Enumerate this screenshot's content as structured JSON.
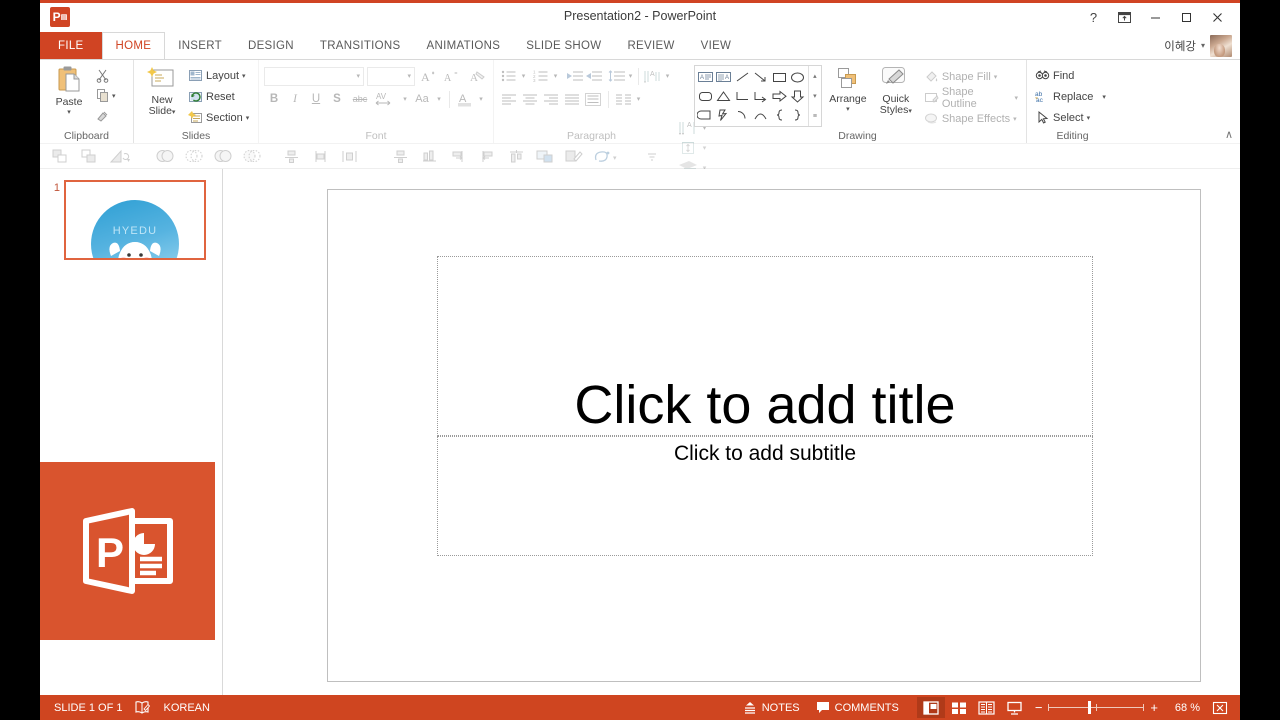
{
  "window": {
    "title": "Presentation2 - PowerPoint",
    "app_icon": "powerpoint-icon",
    "help_label": "?",
    "ribbon_display_label": "ribbon-display-options",
    "minimize_label": "—",
    "restore_label": "❐",
    "close_label": "✕",
    "account_name": "이혜강",
    "account_caret": "▾"
  },
  "tabs": [
    {
      "label": "FILE",
      "kind": "file"
    },
    {
      "label": "HOME",
      "kind": "active"
    },
    {
      "label": "INSERT",
      "kind": "normal"
    },
    {
      "label": "DESIGN",
      "kind": "normal"
    },
    {
      "label": "TRANSITIONS",
      "kind": "normal"
    },
    {
      "label": "ANIMATIONS",
      "kind": "normal"
    },
    {
      "label": "SLIDE SHOW",
      "kind": "normal"
    },
    {
      "label": "REVIEW",
      "kind": "normal"
    },
    {
      "label": "VIEW",
      "kind": "normal"
    }
  ],
  "ribbon": {
    "clipboard": {
      "label": "Clipboard",
      "paste_label": "Paste",
      "paste_caret": "▾",
      "cut_label": "Cut",
      "copy_label": "Copy",
      "copy_caret": "▾",
      "format_painter_label": "Format Painter",
      "dialog_launcher": "⬌"
    },
    "slides": {
      "label": "Slides",
      "new_slide_label": "New\nSlide",
      "new_slide_line1": "New",
      "new_slide_line2": "Slide",
      "new_slide_caret": "▾",
      "layout_label": "Layout",
      "layout_caret": "▾",
      "reset_label": "Reset",
      "section_label": "Section",
      "section_caret": "▾"
    },
    "font": {
      "label": "Font",
      "font_name_value": "",
      "font_name_placeholder": "",
      "font_size_value": "",
      "font_size_placeholder": "",
      "increase_size_label": "A▴",
      "decrease_size_label": "A▾",
      "clear_formatting_label": "Clear All Formatting",
      "bold_label": "B",
      "italic_label": "I",
      "underline_label": "U",
      "shadow_label": "S",
      "strikethrough_label": "abc",
      "char_spacing_label": "AV",
      "change_case_label": "Aa",
      "font_color_label": "A",
      "caret": "▾",
      "dialog_launcher": "⬌",
      "state": "disabled"
    },
    "paragraph": {
      "label": "Paragraph",
      "bullets_label": "Bullets",
      "numbering_label": "Numbering",
      "decrease_indent_label": "Decrease List Level",
      "increase_indent_label": "Increase List Level",
      "line_spacing_label": "Line Spacing",
      "text_direction_label": "Text Direction",
      "align_text_label": "Align Text",
      "smartart_label": "Convert to SmartArt",
      "align_left_label": "Align Left",
      "center_label": "Center",
      "align_right_label": "Align Right",
      "justify_label": "Justify",
      "columns_label": "Columns",
      "caret": "▾",
      "dialog_launcher": "⬌",
      "state": "disabled"
    },
    "drawing": {
      "label": "Drawing",
      "arrange_label": "Arrange",
      "arrange_caret": "▾",
      "quick_styles_line1": "Quick",
      "quick_styles_line2": "Styles",
      "quick_styles_caret": "▾",
      "shape_fill_label": "Shape Fill",
      "shape_outline_label": "Shape Outline",
      "shape_effects_label": "Shape Effects",
      "caret": "▾",
      "dialog_launcher": "⬌",
      "shapes": [
        "textbox",
        "vertical-textbox",
        "line",
        "line-arrow",
        "rectangle",
        "oval",
        "rounded-rectangle",
        "triangle",
        "elbow-connector",
        "elbow-arrow-connector",
        "right-arrow",
        "down-arrow",
        "pentagon-flag",
        "lightning-bolt",
        "arc",
        "curve",
        "left-brace",
        "right-brace"
      ],
      "scroll_up": "▴",
      "scroll_down": "▾",
      "scroll_more": "≡"
    },
    "editing": {
      "label": "Editing",
      "find_label": "Find",
      "replace_label": "Replace",
      "replace_caret": "▾",
      "select_label": "Select",
      "select_caret": "▾"
    },
    "collapse_ribbon_label": "∧"
  },
  "toolbar2": {
    "state": "disabled",
    "buttons": [
      "bring-forward-icon",
      "send-backward-icon",
      "rotate-icon",
      "merge-shapes-union-icon",
      "merge-shapes-combine-icon",
      "merge-shapes-fragment-icon",
      "merge-shapes-subtract-icon",
      "align-center-icon",
      "align-middle-icon",
      "distribute-horizontal-icon",
      "align-bottom-icon",
      "distribute-vertical-icon",
      "align-right-icon",
      "align-left-icon",
      "align-top-icon",
      "group-icon",
      "edit-points-icon",
      "shape-icon",
      "more-icon"
    ]
  },
  "thumbnails": {
    "slides": [
      {
        "number": "1",
        "mascot_text": "HYEDU",
        "mascot_name": "hyedu-mascot"
      }
    ],
    "overlay_logo": "powerpoint-logo"
  },
  "slide": {
    "title_placeholder": "Click to add title",
    "subtitle_placeholder": "Click to add subtitle"
  },
  "status_bar": {
    "slide_count": "SLIDE 1 OF 1",
    "spelling_icon": "spell-check-icon",
    "language": "KOREAN",
    "notes_label": "NOTES",
    "comments_label": "COMMENTS",
    "view_normal": "normal-view-icon",
    "view_slide_sorter": "slide-sorter-view-icon",
    "view_reading": "reading-view-icon",
    "view_slideshow": "slideshow-view-icon",
    "zoom_out_label": "−",
    "zoom_in_label": "+",
    "zoom_value": "68 %",
    "fit_label": "fit-to-window-icon"
  },
  "colors": {
    "accent": "#d04423",
    "status_bar": "#cf4520",
    "thumb_border": "#e0643f",
    "overlay": "#d9542e"
  }
}
